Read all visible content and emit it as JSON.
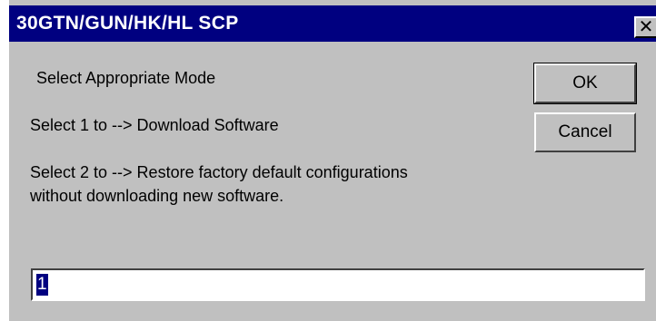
{
  "window": {
    "title": "30GTN/GUN/HK/HL SCP",
    "close_symbol": "✕"
  },
  "dialog": {
    "heading": "Select Appropriate Mode",
    "option1": "Select 1 to --> Download Software",
    "option2_line1": "Select 2 to --> Restore factory default configurations",
    "option2_line2": "without downloading new software."
  },
  "buttons": {
    "ok_label": "OK",
    "cancel_label": "Cancel"
  },
  "input": {
    "value": "1"
  }
}
